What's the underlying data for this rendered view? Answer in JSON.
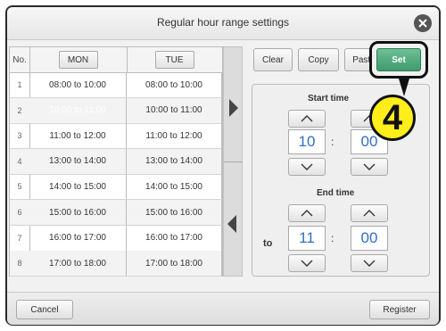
{
  "dialog": {
    "title": "Regular hour range settings"
  },
  "table": {
    "no_header": "No.",
    "days": [
      "MON",
      "TUE"
    ],
    "rows": [
      {
        "no": "1",
        "mon": "08:00 to 10:00",
        "tue": "08:00 to 10:00"
      },
      {
        "no": "2",
        "mon": "10:00 to 11:00",
        "tue": "10:00 to 11:00"
      },
      {
        "no": "3",
        "mon": "11:00 to 12:00",
        "tue": "11:00 to 12:00"
      },
      {
        "no": "4",
        "mon": "13:00 to 14:00",
        "tue": "13:00 to 14:00"
      },
      {
        "no": "5",
        "mon": "14:00 to 15:00",
        "tue": "14:00 to 15:00"
      },
      {
        "no": "6",
        "mon": "15:00 to 16:00",
        "tue": "15:00 to 16:00"
      },
      {
        "no": "7",
        "mon": "16:00 to 17:00",
        "tue": "16:00 to 17:00"
      },
      {
        "no": "8",
        "mon": "17:00 to 18:00",
        "tue": "17:00 to 18:00"
      }
    ],
    "selected_row": 2
  },
  "toolbar": {
    "clear": "Clear",
    "copy": "Copy",
    "paste": "Paste",
    "set": "Set"
  },
  "time": {
    "start_label": "Start time",
    "start_hour": "10",
    "start_minute": "00",
    "end_label": "End time",
    "to_label": "to",
    "end_hour": "11",
    "end_minute": "00",
    "colon": ":"
  },
  "callout": {
    "number": "4"
  },
  "footer": {
    "cancel": "Cancel",
    "register": "Register"
  },
  "colors": {
    "selected": "#2f6fc5",
    "set_button": "#4fa97a",
    "callout": "#ffee1a"
  }
}
